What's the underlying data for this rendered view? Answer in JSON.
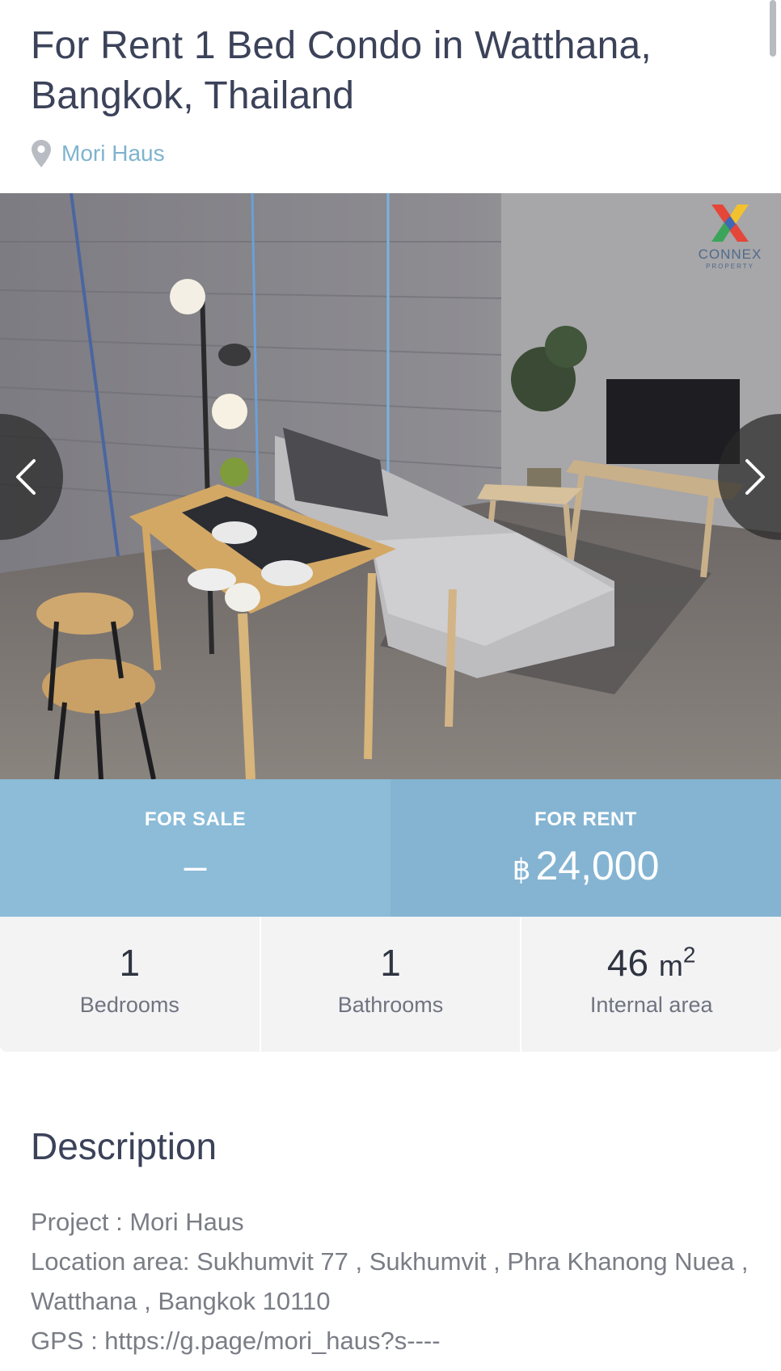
{
  "listing": {
    "title": "For Rent 1 Bed Condo in Watthana, Bangkok, Thailand",
    "project_name": "Mori Haus"
  },
  "gallery": {
    "logo_text": "CONNEX",
    "logo_subtext": "PROPERTY"
  },
  "pricing": {
    "sale_label": "FOR SALE",
    "sale_value": "–",
    "rent_label": "FOR RENT",
    "rent_currency": "฿",
    "rent_value": "24,000"
  },
  "stats": {
    "bedrooms_value": "1",
    "bedrooms_label": "Bedrooms",
    "bathrooms_value": "1",
    "bathrooms_label": "Bathrooms",
    "area_value": "46",
    "area_unit": "m",
    "area_unit_sup": "2",
    "area_label": "Internal area"
  },
  "description": {
    "heading": "Description",
    "lines": [
      "Project : Mori Haus",
      "Location area: Sukhumvit 77 , Sukhumvit , Phra Khanong Nuea , Watthana , Bangkok 10110",
      "GPS : https://g.page/mori_haus?s----"
    ]
  },
  "colors": {
    "accent": "#84b4d2",
    "title_text": "#3b4259",
    "location_text": "#7fb3cf"
  },
  "icons": [
    "pin-icon",
    "chevron-left-icon",
    "chevron-right-icon"
  ]
}
